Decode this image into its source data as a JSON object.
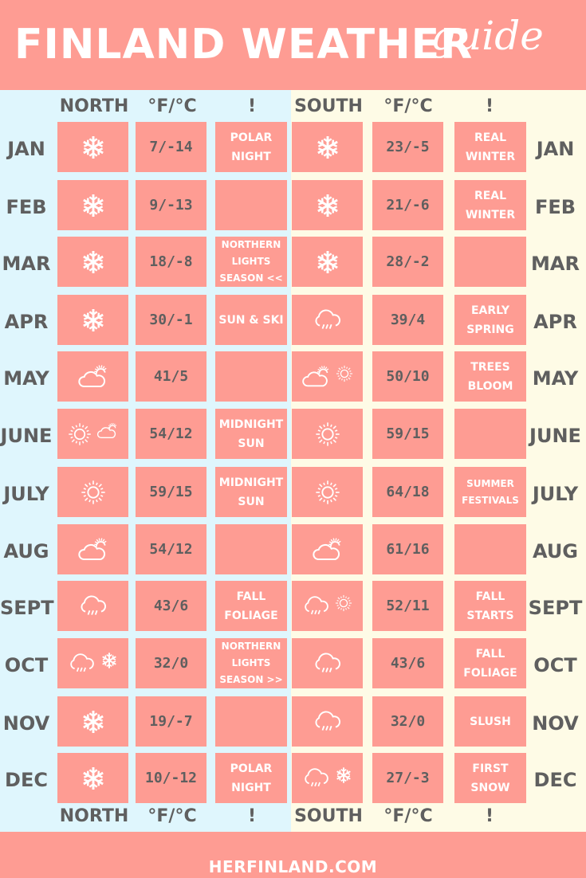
{
  "header": {
    "title": "FINLAND WEATHER",
    "script": "guide"
  },
  "columns": {
    "north": "NORTH",
    "north_temp": "°F/°C",
    "north_note": "!",
    "south": "SOUTH",
    "south_temp": "°F/°C",
    "south_note": "!"
  },
  "colors": {
    "accent": "#fe9c93",
    "north_bg": "#dff6fd",
    "south_bg": "#fefbe6",
    "text": "#5f5f5f"
  },
  "rows": [
    {
      "month": "JAN",
      "north": {
        "icons": [
          "snowflake-icon"
        ],
        "temp": "7/-14",
        "note": "POLAR NIGHT"
      },
      "south": {
        "icons": [
          "snowflake-icon"
        ],
        "temp": "23/-5",
        "note": "REAL WINTER"
      }
    },
    {
      "month": "FEB",
      "north": {
        "icons": [
          "snowflake-icon"
        ],
        "temp": "9/-13",
        "note": ""
      },
      "south": {
        "icons": [
          "snowflake-icon"
        ],
        "temp": "21/-6",
        "note": "REAL WINTER"
      }
    },
    {
      "month": "MAR",
      "north": {
        "icons": [
          "snowflake-icon"
        ],
        "temp": "18/-8",
        "note": "NORTHERN LIGHTS SEASON <<"
      },
      "south": {
        "icons": [
          "snowflake-icon"
        ],
        "temp": "28/-2",
        "note": ""
      }
    },
    {
      "month": "APR",
      "north": {
        "icons": [
          "snowflake-icon"
        ],
        "temp": "30/-1",
        "note": "SUN & SKI"
      },
      "south": {
        "icons": [
          "rain-cloud-icon"
        ],
        "temp": "39/4",
        "note": "EARLY SPRING"
      }
    },
    {
      "month": "MAY",
      "north": {
        "icons": [
          "partly-cloudy-icon"
        ],
        "temp": "41/5",
        "note": ""
      },
      "south": {
        "icons": [
          "partly-cloudy-icon",
          "sun-icon"
        ],
        "temp": "50/10",
        "note": "TREES BLOOM"
      }
    },
    {
      "month": "JUNE",
      "north": {
        "icons": [
          "sun-icon",
          "partly-cloudy-icon"
        ],
        "temp": "54/12",
        "note": "MIDNIGHT SUN"
      },
      "south": {
        "icons": [
          "sun-icon"
        ],
        "temp": "59/15",
        "note": ""
      }
    },
    {
      "month": "JULY",
      "north": {
        "icons": [
          "sun-icon"
        ],
        "temp": "59/15",
        "note": "MIDNIGHT SUN"
      },
      "south": {
        "icons": [
          "sun-icon"
        ],
        "temp": "64/18",
        "note": "SUMMER FESTIVALS"
      }
    },
    {
      "month": "AUG",
      "north": {
        "icons": [
          "partly-cloudy-icon"
        ],
        "temp": "54/12",
        "note": ""
      },
      "south": {
        "icons": [
          "partly-cloudy-icon"
        ],
        "temp": "61/16",
        "note": ""
      }
    },
    {
      "month": "SEPT",
      "north": {
        "icons": [
          "rain-cloud-icon"
        ],
        "temp": "43/6",
        "note": "FALL FOLIAGE"
      },
      "south": {
        "icons": [
          "rain-cloud-icon",
          "sun-icon"
        ],
        "temp": "52/11",
        "note": "FALL STARTS"
      }
    },
    {
      "month": "OCT",
      "north": {
        "icons": [
          "rain-cloud-icon",
          "snowflake-icon"
        ],
        "temp": "32/0",
        "note": "NORTHERN LIGHTS SEASON >>"
      },
      "south": {
        "icons": [
          "rain-cloud-icon"
        ],
        "temp": "43/6",
        "note": "FALL FOLIAGE"
      }
    },
    {
      "month": "NOV",
      "north": {
        "icons": [
          "snowflake-icon"
        ],
        "temp": "19/-7",
        "note": ""
      },
      "south": {
        "icons": [
          "rain-cloud-icon"
        ],
        "temp": "32/0",
        "note": "SLUSH"
      }
    },
    {
      "month": "DEC",
      "north": {
        "icons": [
          "snowflake-icon"
        ],
        "temp": "10/-12",
        "note": "POLAR NIGHT"
      },
      "south": {
        "icons": [
          "rain-cloud-icon",
          "snowflake-icon"
        ],
        "temp": "27/-3",
        "note": "FIRST SNOW"
      }
    }
  ],
  "footer": {
    "site": "HERFINLAND.COM"
  }
}
